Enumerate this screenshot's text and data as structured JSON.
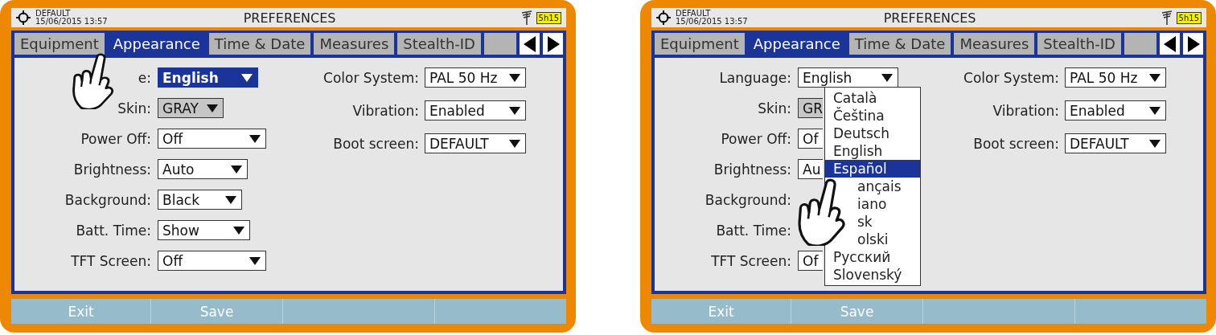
{
  "screens": [
    {
      "title_bar": {
        "profile": "DEFAULT",
        "datetime": "15/06/2015 13:57",
        "title": "PREFERENCES",
        "battery": "5h15"
      },
      "tabs": [
        {
          "label": "Equipment",
          "selected": false
        },
        {
          "label": "Appearance",
          "selected": true
        },
        {
          "label": "Time & Date",
          "selected": false
        },
        {
          "label": "Measures",
          "selected": false
        },
        {
          "label": "Stealth-ID",
          "selected": false
        }
      ],
      "left_settings": [
        {
          "label": "e:",
          "value": "English",
          "focused": true,
          "disabled": false
        },
        {
          "label": "Skin:",
          "value": "GRAY",
          "focused": false,
          "disabled": true
        },
        {
          "label": "Power Off:",
          "value": "Off",
          "focused": false,
          "disabled": false
        },
        {
          "label": "Brightness:",
          "value": "Auto",
          "focused": false,
          "disabled": false
        },
        {
          "label": "Background:",
          "value": "Black",
          "focused": false,
          "disabled": false
        },
        {
          "label": "Batt. Time:",
          "value": "Show",
          "focused": false,
          "disabled": false
        },
        {
          "label": "TFT Screen:",
          "value": "Off",
          "focused": false,
          "disabled": false
        }
      ],
      "right_settings": [
        {
          "label": "Color System:",
          "value": "PAL 50 Hz",
          "focused": false,
          "disabled": false
        },
        {
          "label": "Vibration:",
          "value": "Enabled",
          "focused": false,
          "disabled": false
        },
        {
          "label": "Boot screen:",
          "value": "DEFAULT",
          "focused": false,
          "disabled": false
        }
      ],
      "softkeys": [
        "Exit",
        "Save"
      ],
      "hand_pointer": true
    },
    {
      "title_bar": {
        "profile": "DEFAULT",
        "datetime": "15/06/2015 13:57",
        "title": "PREFERENCES",
        "battery": "5h15"
      },
      "tabs": [
        {
          "label": "Equipment",
          "selected": false
        },
        {
          "label": "Appearance",
          "selected": true
        },
        {
          "label": "Time & Date",
          "selected": false
        },
        {
          "label": "Measures",
          "selected": false
        },
        {
          "label": "Stealth-ID",
          "selected": false
        }
      ],
      "left_settings": [
        {
          "label": "Language:",
          "value": "English",
          "focused": false,
          "disabled": false,
          "covered": false
        },
        {
          "label": "Skin:",
          "value": "GR",
          "focused": false,
          "disabled": true,
          "covered": true
        },
        {
          "label": "Power Off:",
          "value": "Of",
          "focused": false,
          "disabled": false,
          "covered": true
        },
        {
          "label": "Brightness:",
          "value": "Au",
          "focused": false,
          "disabled": false,
          "covered": true
        },
        {
          "label": "Background:"
        },
        {
          "label": "Batt. Time:"
        },
        {
          "label": "TFT Screen:",
          "value": "Of",
          "focused": false,
          "disabled": false,
          "covered": true
        }
      ],
      "right_settings": [
        {
          "label": "Color System:",
          "value": "PAL 50 Hz",
          "focused": false,
          "disabled": false
        },
        {
          "label": "Vibration:",
          "value": "Enabled",
          "focused": false,
          "disabled": false
        },
        {
          "label": "Boot screen:",
          "value": "DEFAULT",
          "focused": false,
          "disabled": false
        }
      ],
      "menu": [
        {
          "label": "Català",
          "selected": false
        },
        {
          "label": "Čeština",
          "selected": false
        },
        {
          "label": "Deutsch",
          "selected": false
        },
        {
          "label": "English",
          "selected": false
        },
        {
          "label": "Español",
          "selected": true
        },
        {
          "label": "ançais",
          "selected": false,
          "covered": true
        },
        {
          "label": "iano",
          "selected": false,
          "covered": true
        },
        {
          "label": "sk",
          "selected": false,
          "covered": true
        },
        {
          "label": "olski",
          "selected": false,
          "covered": true
        },
        {
          "label": "Русский",
          "selected": false
        },
        {
          "label": "Slovenský",
          "selected": false
        }
      ],
      "softkeys": [
        "Exit",
        "Save"
      ],
      "hand_pointer": true
    }
  ]
}
